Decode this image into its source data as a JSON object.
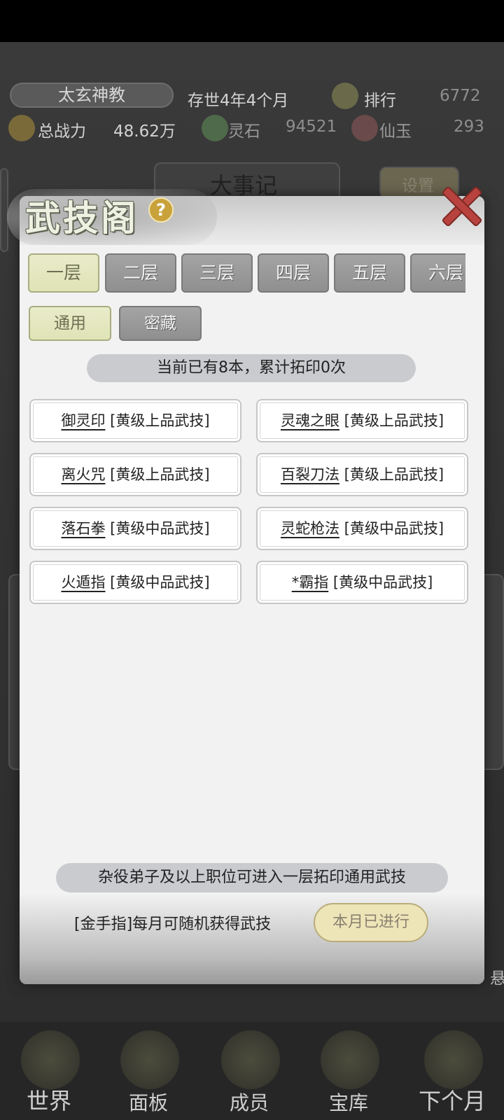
{
  "top_bar": {
    "sect_name": "太玄神教",
    "age": "存世4年4个月",
    "rank_label": "排行",
    "rank_value": "6772",
    "power_label": "总战力",
    "power_value": "48.62万",
    "spirit_stone_label": "灵石",
    "spirit_stone_value": "94521",
    "jade_label": "仙玉",
    "jade_value": "293"
  },
  "background": {
    "chronicle_label": "大事记",
    "settings_label": "设置"
  },
  "modal": {
    "title": "武技阁",
    "help_symbol": "?",
    "floors": [
      "一层",
      "二层",
      "三层",
      "四层",
      "五层",
      "六层"
    ],
    "active_floor": "一层",
    "subtabs": [
      "通用",
      "密藏"
    ],
    "active_subtab": "通用",
    "summary": "当前已有8本，累计拓印0次",
    "skills": [
      {
        "name": "御灵印",
        "grade": "[黄级上品武技]"
      },
      {
        "name": "灵魂之眼",
        "grade": "[黄级上品武技]"
      },
      {
        "name": "离火咒",
        "grade": "[黄级上品武技]"
      },
      {
        "name": "百裂刀法",
        "grade": "[黄级上品武技]"
      },
      {
        "name": "落石拳",
        "grade": "[黄级中品武技]"
      },
      {
        "name": "灵蛇枪法",
        "grade": "[黄级中品武技]"
      },
      {
        "name": "火遁指",
        "grade": "[黄级中品武技]"
      },
      {
        "name": "*霸指",
        "grade": "[黄级中品武技]"
      }
    ],
    "rule": "杂役弟子及以上职位可进入一层拓印通用武技",
    "golden_finger": "[金手指]每月可随机获得武技",
    "monthly_button": "本月已进行"
  },
  "bottom_nav": [
    "世界",
    "面板",
    "成员",
    "宝库",
    "下个月"
  ],
  "side_glyph": "悬"
}
